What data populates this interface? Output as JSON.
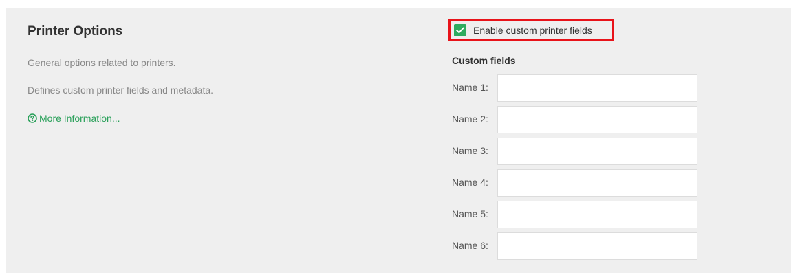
{
  "section": {
    "title": "Printer Options",
    "description_1": "General options related to printers.",
    "description_2": "Defines custom printer fields and metadata.",
    "more_info_label": "More Information...",
    "more_info_icon": "help-circle-icon"
  },
  "enable_custom_fields": {
    "label": "Enable custom printer fields",
    "checked": true,
    "icon": "checkmark-icon"
  },
  "custom_fields": {
    "title": "Custom fields",
    "fields": [
      {
        "label": "Name 1:",
        "value": ""
      },
      {
        "label": "Name 2:",
        "value": ""
      },
      {
        "label": "Name 3:",
        "value": ""
      },
      {
        "label": "Name 4:",
        "value": ""
      },
      {
        "label": "Name 5:",
        "value": ""
      },
      {
        "label": "Name 6:",
        "value": ""
      }
    ]
  },
  "colors": {
    "panel_background": "#efefef",
    "checkbox_green": "#2eac5f",
    "link_green": "#2aa05a",
    "highlight_red": "#e8131a"
  }
}
